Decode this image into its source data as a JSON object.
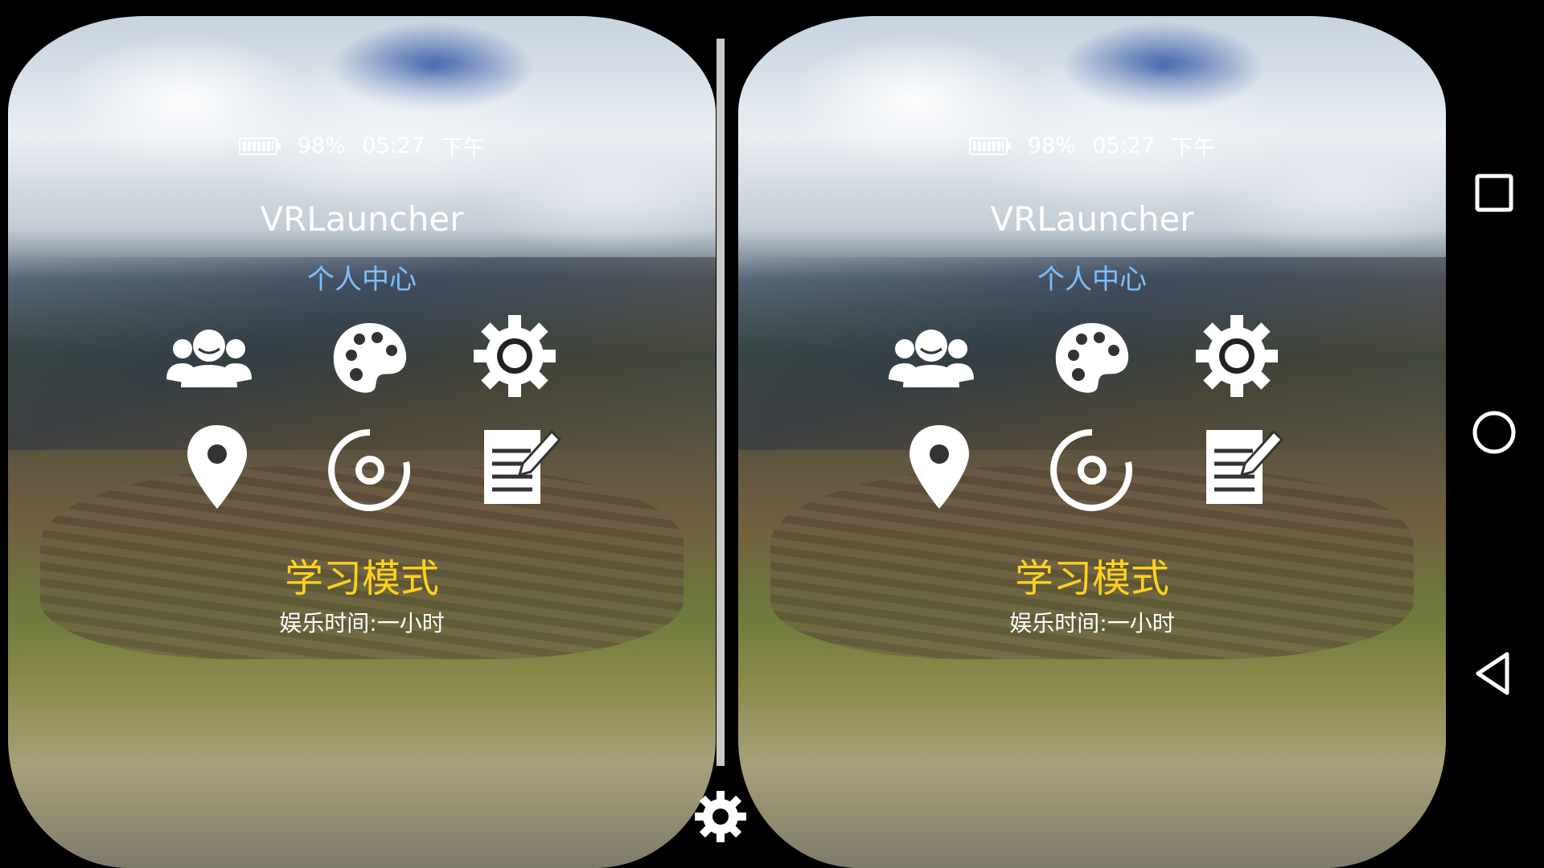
{
  "status": {
    "battery": "98%",
    "time": "05:27",
    "period": "下午"
  },
  "app": {
    "title": "VRLauncher",
    "subtitle": "个人中心"
  },
  "icons": {
    "row1": [
      "users-icon",
      "palette-icon",
      "gear-icon"
    ],
    "row2": [
      "location-pin-icon",
      "record-icon",
      "notes-edit-icon"
    ]
  },
  "mode": {
    "label": "学习模式",
    "entertainment_time": "娱乐时间:一小时"
  },
  "nav": {
    "items": [
      "recent-apps-icon",
      "home-icon",
      "back-icon"
    ]
  },
  "colors": {
    "subtitle": "#7cc0ff",
    "mode": "#ffd21e",
    "icon": "#ffffff",
    "background": "#000000"
  }
}
